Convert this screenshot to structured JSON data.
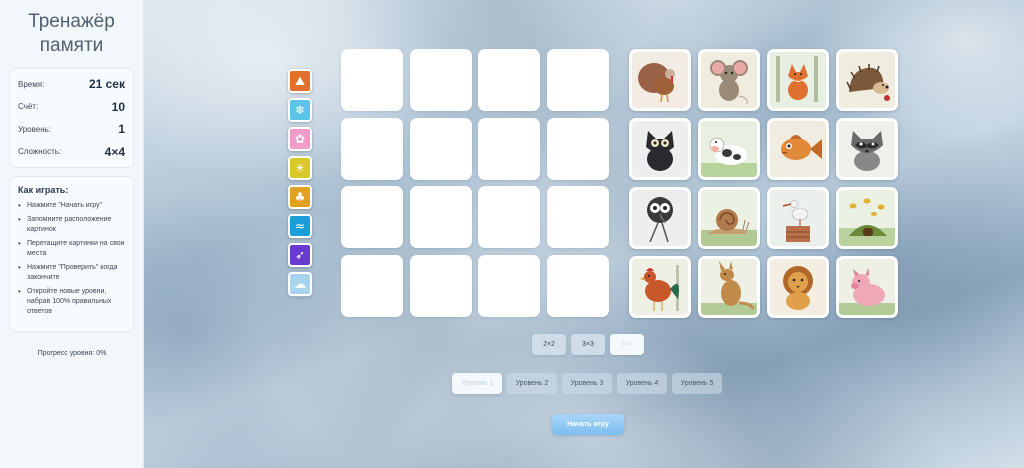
{
  "app": {
    "title": "Тренажёр памяти"
  },
  "stats": [
    {
      "label": "Время:",
      "value": "21 сек"
    },
    {
      "label": "Счёт:",
      "value": "10"
    },
    {
      "label": "Уровень:",
      "value": "1"
    },
    {
      "label": "Сложность:",
      "value": "4×4"
    }
  ],
  "howto": {
    "title": "Как играть:",
    "steps": [
      "Нажмите \"Начать игру\"",
      "Запомните расположение картинок",
      "Перетащите картинки на свои места",
      "Нажмите \"Проверить\" когда закончите",
      "Откройте новые уровни, набрав 100% правильных ответов"
    ]
  },
  "progress": {
    "text": "Прогресс уровня: 0%",
    "value": 0
  },
  "palette": {
    "selected_index": 7,
    "swatches": [
      {
        "icon": "mountain-icon",
        "glyph": "⛰",
        "color": "#e0702a"
      },
      {
        "icon": "snowflake-icon",
        "glyph": "❄",
        "color": "#5cc4e8"
      },
      {
        "icon": "flower-icon",
        "glyph": "✿",
        "color": "#f29bc8"
      },
      {
        "icon": "sun-icon",
        "glyph": "☀",
        "color": "#d8c82a"
      },
      {
        "icon": "palm-icon",
        "glyph": "♣",
        "color": "#e0a020"
      },
      {
        "icon": "wave-icon",
        "glyph": "≈",
        "color": "#1a9fd8"
      },
      {
        "icon": "rocket-icon",
        "glyph": "➶",
        "color": "#6a3ad0"
      },
      {
        "icon": "cloud-icon",
        "glyph": "☁",
        "color": "#a8d4ee"
      }
    ]
  },
  "cards": [
    {
      "animal": "turkey",
      "bg": "#f3ece4",
      "color": "#8a4a2a",
      "accent": "#d03030"
    },
    {
      "animal": "mouse",
      "bg": "#f1ece0",
      "color": "#9a8a78",
      "accent": "#e8a8a8"
    },
    {
      "animal": "fox",
      "bg": "#e6efe2",
      "color": "#e07030",
      "accent": "#ffffff"
    },
    {
      "animal": "hedgehog",
      "bg": "#f1ece0",
      "color": "#7a5a3a",
      "accent": "#c03030"
    },
    {
      "animal": "cat",
      "bg": "#eceef0",
      "color": "#2a2a2e",
      "accent": "#e8e0c0"
    },
    {
      "animal": "cow",
      "bg": "#e8f0e2",
      "color": "#3a3a3a",
      "accent": "#ffffff"
    },
    {
      "animal": "fish",
      "bg": "#f0ece2",
      "color": "#e08a3a",
      "accent": "#c06a2a"
    },
    {
      "animal": "raccoon",
      "bg": "#eef0ea",
      "color": "#6a6a6a",
      "accent": "#2a2a2a"
    },
    {
      "animal": "bird",
      "bg": "#eceef0",
      "color": "#3a3a3a",
      "accent": "#ffffff"
    },
    {
      "animal": "snail",
      "bg": "#ebf1e3",
      "color": "#b07a4a",
      "accent": "#8ab060"
    },
    {
      "animal": "stork",
      "bg": "#ebf0ec",
      "color": "#f4f4f4",
      "accent": "#b04a2a"
    },
    {
      "animal": "bees",
      "bg": "#ebf1e3",
      "color": "#6a8a3a",
      "accent": "#e0b030"
    },
    {
      "animal": "rooster",
      "bg": "#eef0e6",
      "color": "#c8582a",
      "accent": "#d03030"
    },
    {
      "animal": "kangaroo",
      "bg": "#eef0e6",
      "color": "#c08a4a",
      "accent": "#8ab060"
    },
    {
      "animal": "lion",
      "bg": "#f4eee2",
      "color": "#e0a04a",
      "accent": "#b0682a"
    },
    {
      "animal": "pig",
      "bg": "#eef0e6",
      "color": "#f0a8b8",
      "accent": "#8ab060"
    }
  ],
  "sizes": [
    {
      "label": "2×2"
    },
    {
      "label": "3×3"
    },
    {
      "label": "4×4"
    }
  ],
  "active_size_index": 2,
  "levels": [
    {
      "label": "Уровень 1"
    },
    {
      "label": "Уровень 2"
    },
    {
      "label": "Уровень 3"
    },
    {
      "label": "Уровень 4"
    },
    {
      "label": "Уровень 5"
    }
  ],
  "active_level_index": 0,
  "start_button": {
    "label": "Начать игру"
  }
}
